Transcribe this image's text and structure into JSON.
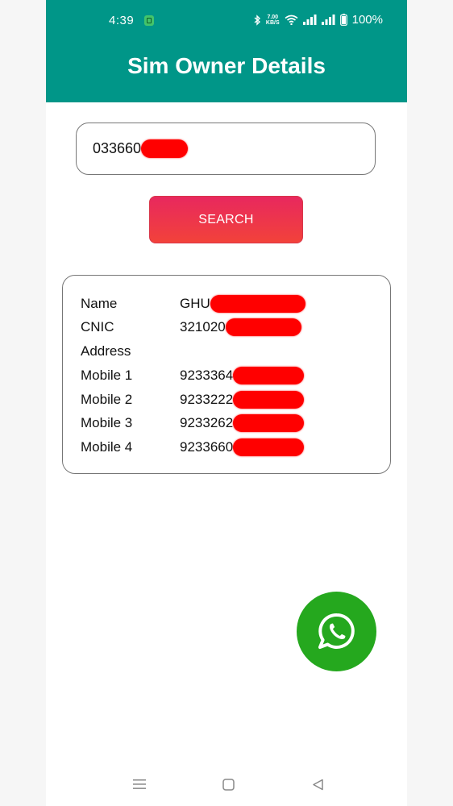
{
  "status_bar": {
    "time": "4:39",
    "net_speed_value": "7.00",
    "net_speed_unit": "KB/S",
    "battery": "100%"
  },
  "app": {
    "title": "Sim Owner Details"
  },
  "search": {
    "value": "033660",
    "button_label": "SEARCH"
  },
  "details": [
    {
      "label": "Name",
      "value": "GHU"
    },
    {
      "label": "CNIC",
      "value": "321020"
    },
    {
      "label": "Address",
      "value": ""
    },
    {
      "label": "Mobile 1",
      "value": "9233364"
    },
    {
      "label": "Mobile 2",
      "value": "9233222"
    },
    {
      "label": "Mobile 3",
      "value": "9233262"
    },
    {
      "label": "Mobile 4",
      "value": "9233660"
    }
  ],
  "colors": {
    "header": "#009688",
    "button_top": "#e8285e",
    "button_bottom": "#f2423a",
    "whatsapp": "#25a81e",
    "redaction": "#ff0000"
  }
}
